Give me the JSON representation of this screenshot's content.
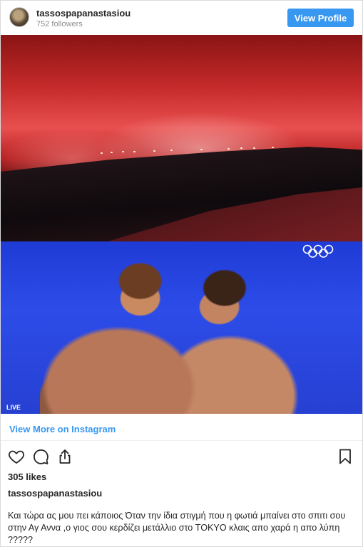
{
  "header": {
    "username": "tassospapanastasiou",
    "followers": "752 followers",
    "view_profile_label": "View Profile"
  },
  "media": {
    "live_label": "LIVE",
    "icons": [
      "olympic-rings-icon"
    ]
  },
  "view_more_label": "View More on Instagram",
  "actions": {
    "icons": [
      "heart-icon",
      "comment-icon",
      "share-icon",
      "save-icon"
    ]
  },
  "likes": "305 likes",
  "caption": {
    "username": "tassospapanastasiou",
    "text": "Και τώρα ας μου πει κάποιος Όταν την ίδια στιγμή που η φωτιά μπαίνει στο σπιτι σου στην Αγ Αννα ,ο γιος σου κερδίζει μετάλλιο στο TOKYO κλαις απο χαρά η απο λύπη ?????"
  },
  "colors": {
    "accent": "#3897f0",
    "text": "#262626",
    "muted": "#8e8e8e"
  }
}
